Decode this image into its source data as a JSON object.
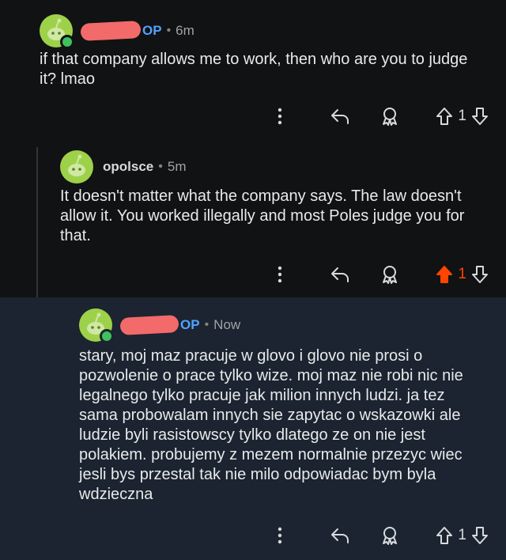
{
  "comments": [
    {
      "is_op": true,
      "op_label": "OP",
      "username": "",
      "time": "6m",
      "body": "if that company allows me to work, then who are you to judge it? lmao",
      "score": "1",
      "upvoted": false
    },
    {
      "is_op": false,
      "op_label": "",
      "username": "opolsce",
      "time": "5m",
      "body": "It doesn't matter what the company says. The law doesn't allow it. You worked illegally and most Poles judge you for that.",
      "score": "1",
      "upvoted": true
    },
    {
      "is_op": true,
      "op_label": "OP",
      "username": "",
      "time": "Now",
      "body": "stary, moj maz pracuje w glovo i glovo nie prosi o pozwolenie o prace tylko wize. moj maz nie robi nic nie legalnego tylko pracuje jak milion innych ludzi. ja tez sama probowalam innych sie zapytac o wskazowki ale ludzie byli rasistowscy tylko dlatego ze on nie jest polakiem. probujemy z mezem normalnie przezyc wiec jesli bys przestal tak nie milo odpowiadac bym byla wdzieczna",
      "score": "1",
      "upvoted": false
    }
  ],
  "icons": {
    "separator": "•",
    "more": "kebab-icon",
    "reply": "reply-icon",
    "award": "award-icon",
    "upvote": "upvote-icon",
    "downvote": "downvote-icon"
  },
  "colors": {
    "op_tag": "#4ea3ff",
    "upvoted": "#ff4500",
    "highlight_bg": "#1b2430"
  }
}
